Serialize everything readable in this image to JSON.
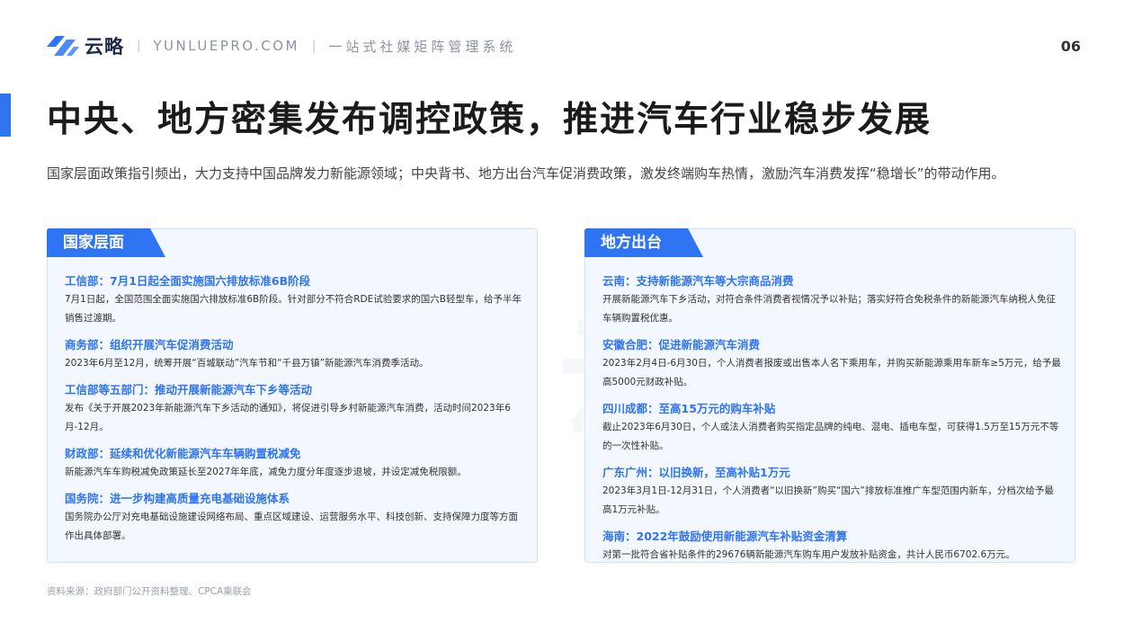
{
  "header": {
    "brand": "云略",
    "site": "YUNLUEPRO.COM",
    "tagline": "一站式社媒矩阵管理系统",
    "page_number": "06"
  },
  "title": "中央、地方密集发布调控政策，推进汽车行业稳步发展",
  "intro": "国家层面政策指引频出，大力支持中国品牌发力新能源领域；中央背书、地方出台汽车促消费政策，激发终端购车热情，激励汽车消费发挥“稳增长”的带动作用。",
  "national": {
    "heading": "国家层面",
    "items": [
      {
        "title": "工信部：7月1日起全面实施国六排放标准6B阶段",
        "body": "7月1日起，全国范围全面实施国六排放标准6B阶段。针对部分不符合RDE试验要求的国六B轻型车，给予半年销售过渡期。"
      },
      {
        "title": "商务部：组织开展汽车促消费活动",
        "body": "2023年6月至12月，统筹开展“百城联动”汽车节和“千县万镇”新能源汽车消费季活动。"
      },
      {
        "title": "工信部等五部门：推动开展新能源汽车下乡等活动",
        "body": "发布《关于开展2023年新能源汽车下乡活动的通知》，将促进引导乡村新能源汽车消费，活动时间2023年6月-12月。"
      },
      {
        "title": "财政部：延续和优化新能源汽车车辆购置税减免",
        "body": "新能源汽车车购税减免政策延长至2027年年底，减免力度分年度逐步退坡，并设定减免税限额。"
      },
      {
        "title": "国务院：进一步构建高质量充电基础设施体系",
        "body": "国务院办公厅对充电基础设施建设网络布局、重点区域建设、运营服务水平、科技创新、支持保障力度等方面作出具体部署。"
      }
    ]
  },
  "local": {
    "heading": "地方出台",
    "items": [
      {
        "title": "云南：支持新能源汽车等大宗商品消费",
        "body": "开展新能源汽车下乡活动，对符合条件消费者视情况予以补贴；落实好符合免税条件的新能源汽车纳税人免征车辆购置税优惠。"
      },
      {
        "title": "安徽合肥：促进新能源汽车消费",
        "body": "2023年2月4日-6月30日，个人消费者报废或出售本人名下乘用车，并购买新能源乘用车新车≥5万元，给予最高5000元财政补贴。"
      },
      {
        "title": "四川成都：至高15万元的购车补贴",
        "body": "截止2023年6月30日，个人或法人消费者购买指定品牌的纯电、混电、插电车型，可获得1.5万至15万元不等的一次性补贴。"
      },
      {
        "title": "广东广州：以旧换新，至高补贴1万元",
        "body": "2023年3月1日-12月31日，个人消费者“以旧换新”购买“国六”排放标准推广车型范围内新车，分档次给予最高1万元补贴。"
      },
      {
        "title": "海南：2022年鼓励使用新能源汽车补贴资金清算",
        "body": "对第一批符合省补贴条件的29676辆新能源汽车购车用户发放补贴资金，共计人民币6702.6万元。"
      }
    ]
  },
  "source": "资料来源：政府部门公开资料整理、CPCA乘联会",
  "colors": {
    "accent": "#2f74f2",
    "panel_bg": "#f3f7ff"
  }
}
